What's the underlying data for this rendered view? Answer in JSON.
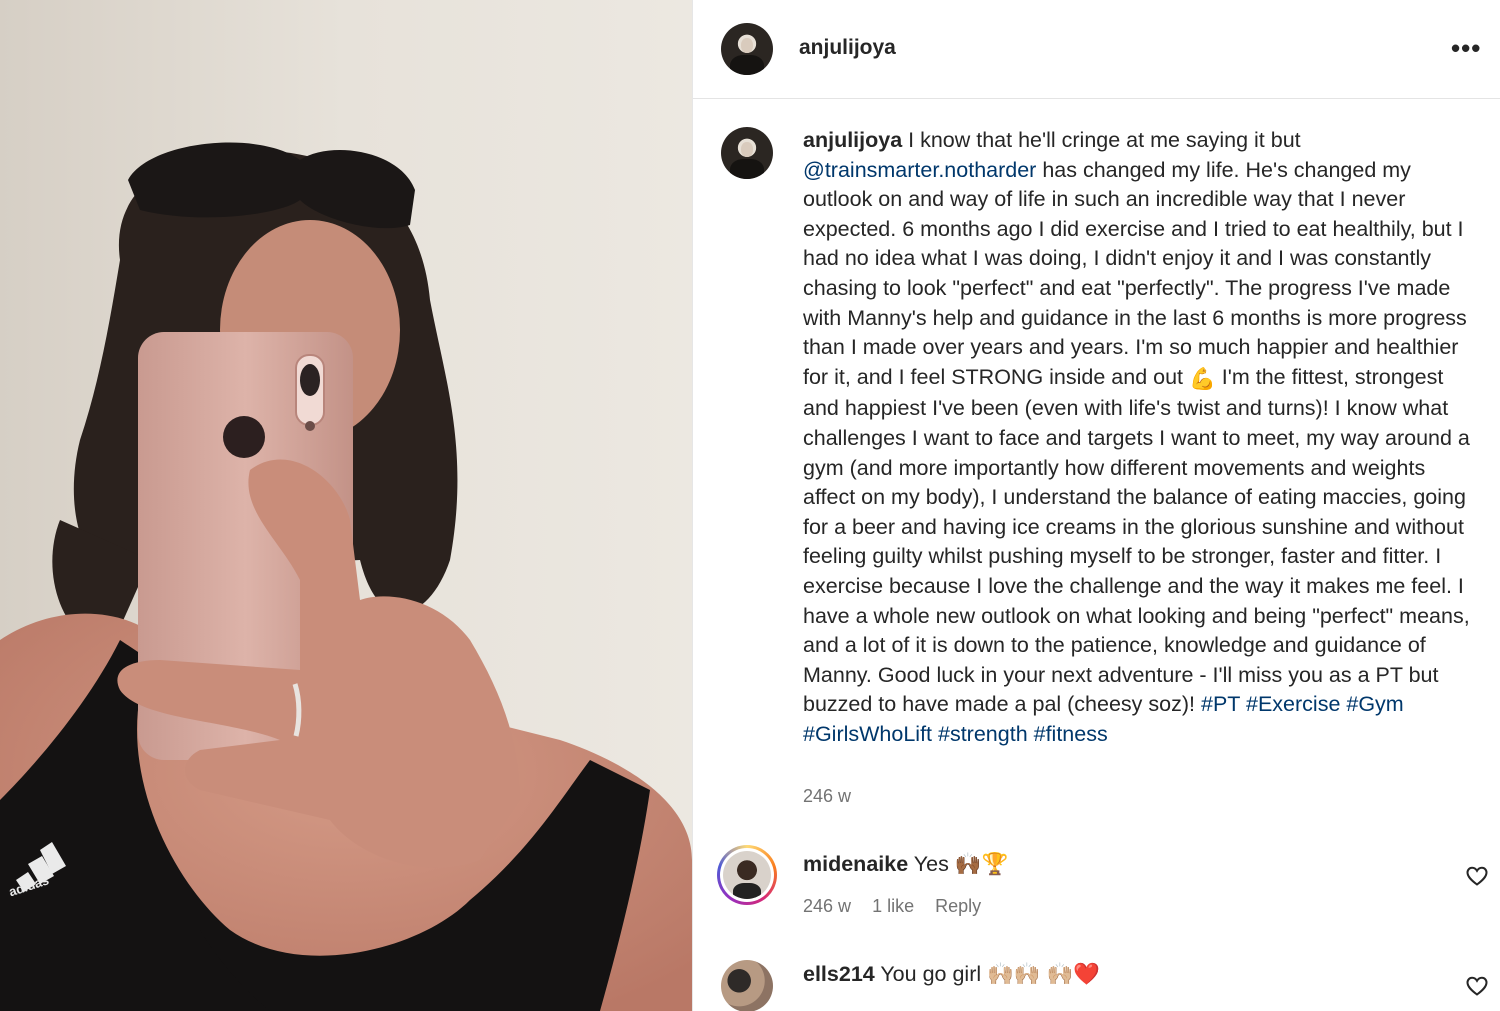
{
  "post": {
    "username": "anjulijoya",
    "more_icon": "more-horizontal-icon",
    "caption": {
      "username": "anjulijoya",
      "text_before": " I know that he'll cringe at me saying it but ",
      "mention": "@trainsmarter.notharder",
      "text_part2": " has changed my life. He's changed my outlook on and way of life in such an incredible way that I never expected. 6 months ago I did exercise and I tried to eat healthily, but I had no idea what I was doing, I didn't enjoy it and I was constantly chasing to look \"perfect\" and eat \"perfectly\". The progress I've made with Manny's help and guidance in the last 6 months is more progress than I made over years and years. I'm so much happier and healthier for it, and I feel STRONG inside and out ",
      "emoji": "💪",
      "text_part3": " I'm the fittest, strongest and happiest I've been (even with life's twist and turns)! I know what challenges I want to face and targets I want to meet, my way around a gym (and more importantly how different movements and weights affect on my body), I understand the balance of eating maccies, going for a beer and having ice creams in the glorious sunshine and without feeling guilty whilst pushing myself to be stronger, faster and fitter. I exercise because I love the challenge and the way it makes me feel. I have a whole new outlook on what looking and being \"perfect\" means, and a lot of it is down to the patience, knowledge and guidance of Manny. Good luck in your next adventure - I'll miss you as a PT but buzzed to have made a pal (cheesy soz)! ",
      "hashtags": "#PT #Exercise #Gym #GirlsWhoLift #strength #fitness"
    },
    "time": "246 w"
  },
  "comments": [
    {
      "username": "midenaike",
      "text": " Yes 🙌🏾🏆",
      "time": "246 w",
      "likes": "1 like",
      "reply": "Reply"
    },
    {
      "username": "ells214",
      "text": " You go girl 🙌🏼🙌🏼 🙌🏼❤️"
    }
  ],
  "colors": {
    "mention": "#00376b",
    "meta": "#737373",
    "text": "#262626"
  }
}
